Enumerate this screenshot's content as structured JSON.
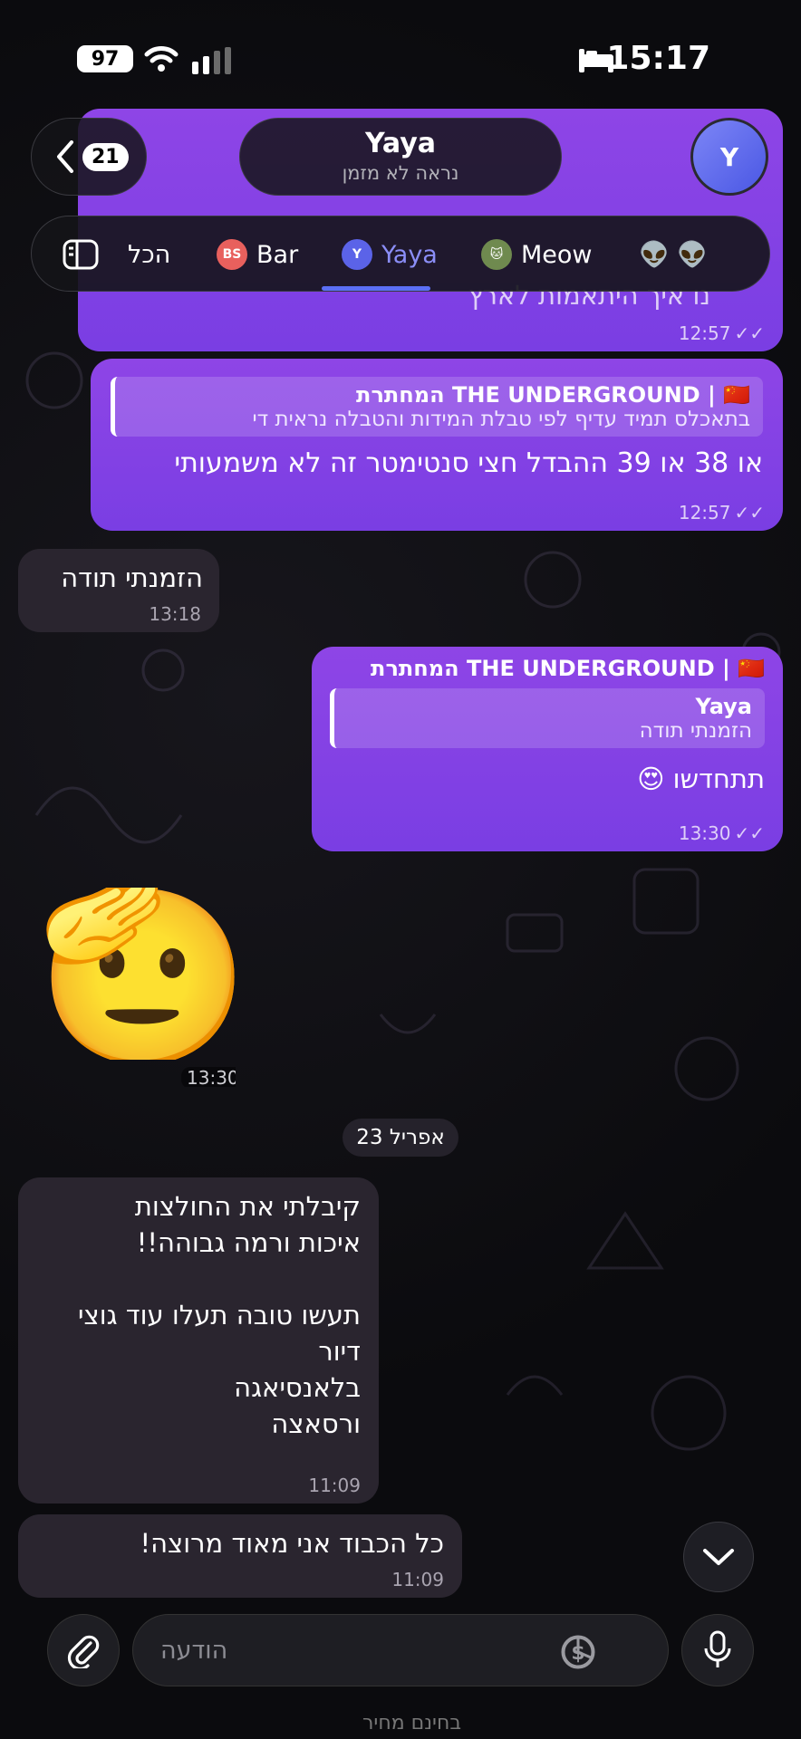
{
  "status": {
    "battery": "97",
    "time": "15:17"
  },
  "header": {
    "back_count": "21",
    "chat_name": "Yaya",
    "chat_status": "נראה לא מזמן",
    "avatar_letter": "Y"
  },
  "tabs": [
    {
      "label": "הכל"
    },
    {
      "label": "Bar",
      "badge": "BS"
    },
    {
      "label": "Yaya",
      "badge": "Y"
    },
    {
      "label": "Meow"
    },
    {
      "label": "👽 👽"
    }
  ],
  "messages": {
    "top_partial": {
      "text": "נו איך היתאמות לארץ",
      "time": "12:57"
    },
    "m1": {
      "quote_title": "THE UNDERGROUND | 🇨🇳 המחתרת",
      "quote_text": "בתאכלס תמיד עדיף לפי טבלת המידות והטבלה נראית די",
      "text": "או 38 או 39 ההבדל חצי סנטימטר זה לא משמעותי",
      "time": "12:57"
    },
    "m2": {
      "text": "הזמנתי תודה",
      "time": "13:18"
    },
    "m3": {
      "sender": "THE UNDERGROUND | 🇨🇳 המחתרת",
      "quote_title": "Yaya",
      "quote_text": "הזמנתי תודה",
      "text": "תתחדשו 😍",
      "time": "13:30"
    },
    "sticker": {
      "emoji": "🫡",
      "time": "13:30"
    },
    "date_divider": "23 אפריל",
    "m4": {
      "lines": [
        "קיבלתי את החולצות",
        "איכות ורמה גבוהה!!",
        "",
        "תעשו טובה תעלו עוד גוצי",
        "דיור",
        "בלאנסיאגה",
        "ורסאצה"
      ],
      "time": "11:09"
    },
    "m5": {
      "text": "כל הכבוד אני מאוד מרוצה!",
      "time": "11:09"
    }
  },
  "composer": {
    "placeholder": "הודעה",
    "under_text": "בחינם מחיר"
  },
  "colors": {
    "outgoing": "#8e45e6",
    "incoming": "#2a252f",
    "accent": "#5b6ff5"
  },
  "icons": [
    "back-chevron-icon",
    "sidebar-icon",
    "attach-icon",
    "dollar-icon",
    "sticker-icon",
    "mic-icon",
    "chevron-down-icon"
  ]
}
